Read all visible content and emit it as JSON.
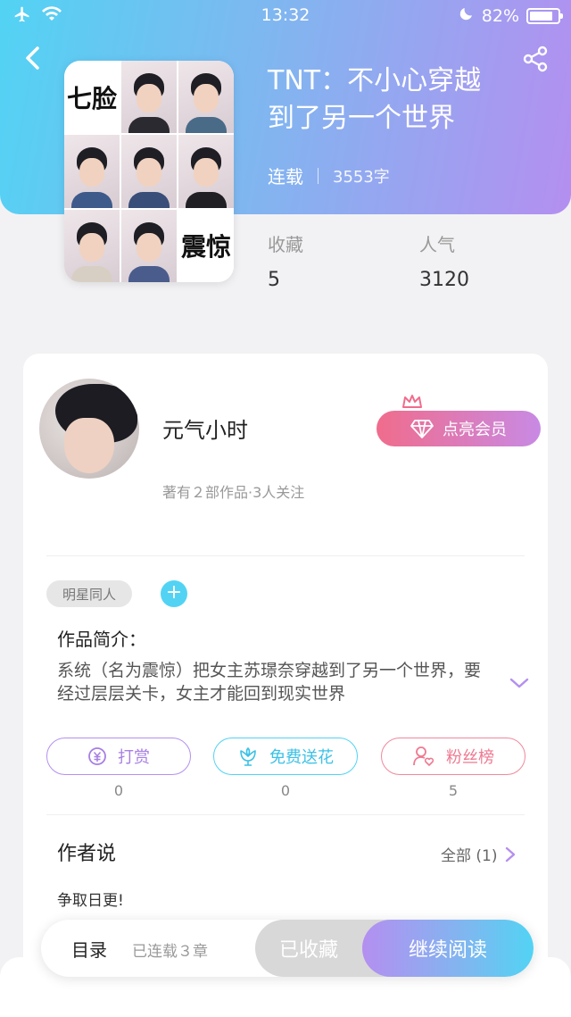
{
  "status_bar": {
    "time": "13:32",
    "battery_text": "82%",
    "battery_level": 0.82,
    "icons": [
      "airplane-icon",
      "wifi-icon",
      "moon-icon",
      "battery-icon"
    ]
  },
  "book": {
    "title_line1": "TNT：不小心穿越",
    "title_line2": "到了另一个世界",
    "status": "连载",
    "word_count": "3553字",
    "cover_text_1": "七脸",
    "cover_text_2": "震惊"
  },
  "stats": {
    "favorites_label": "收藏",
    "favorites_value": "5",
    "popularity_label": "人气",
    "popularity_value": "3120"
  },
  "author": {
    "name": "元气小时",
    "subtitle": "著有２部作品·3人关注",
    "vip_button": "点亮会员"
  },
  "tags": {
    "items": [
      "明星同人"
    ],
    "add_symbol": "+"
  },
  "intro": {
    "title": "作品简介：",
    "body": "系统（名为震惊）把女主苏璟奈穿越到了另一个世界，要经过层层关卡，女主才能回到现实世界"
  },
  "actions": [
    {
      "label": "打赏",
      "count": "0",
      "icon": "coin-icon"
    },
    {
      "label": "免费送花",
      "count": "0",
      "icon": "flower-icon"
    },
    {
      "label": "粉丝榜",
      "count": "5",
      "icon": "user-heart-icon"
    }
  ],
  "author_says": {
    "title": "作者说",
    "see_all": "全部 (1)",
    "note": "争取日更!"
  },
  "bottom_bar": {
    "toc_label": "目录",
    "toc_sub": "已连载３章",
    "collected_label": "已收藏",
    "read_label": "继续阅读"
  },
  "colors": {
    "gradient_start": "#52d3f4",
    "gradient_end": "#b48ff0",
    "vip_pink": "#f06c8c"
  }
}
